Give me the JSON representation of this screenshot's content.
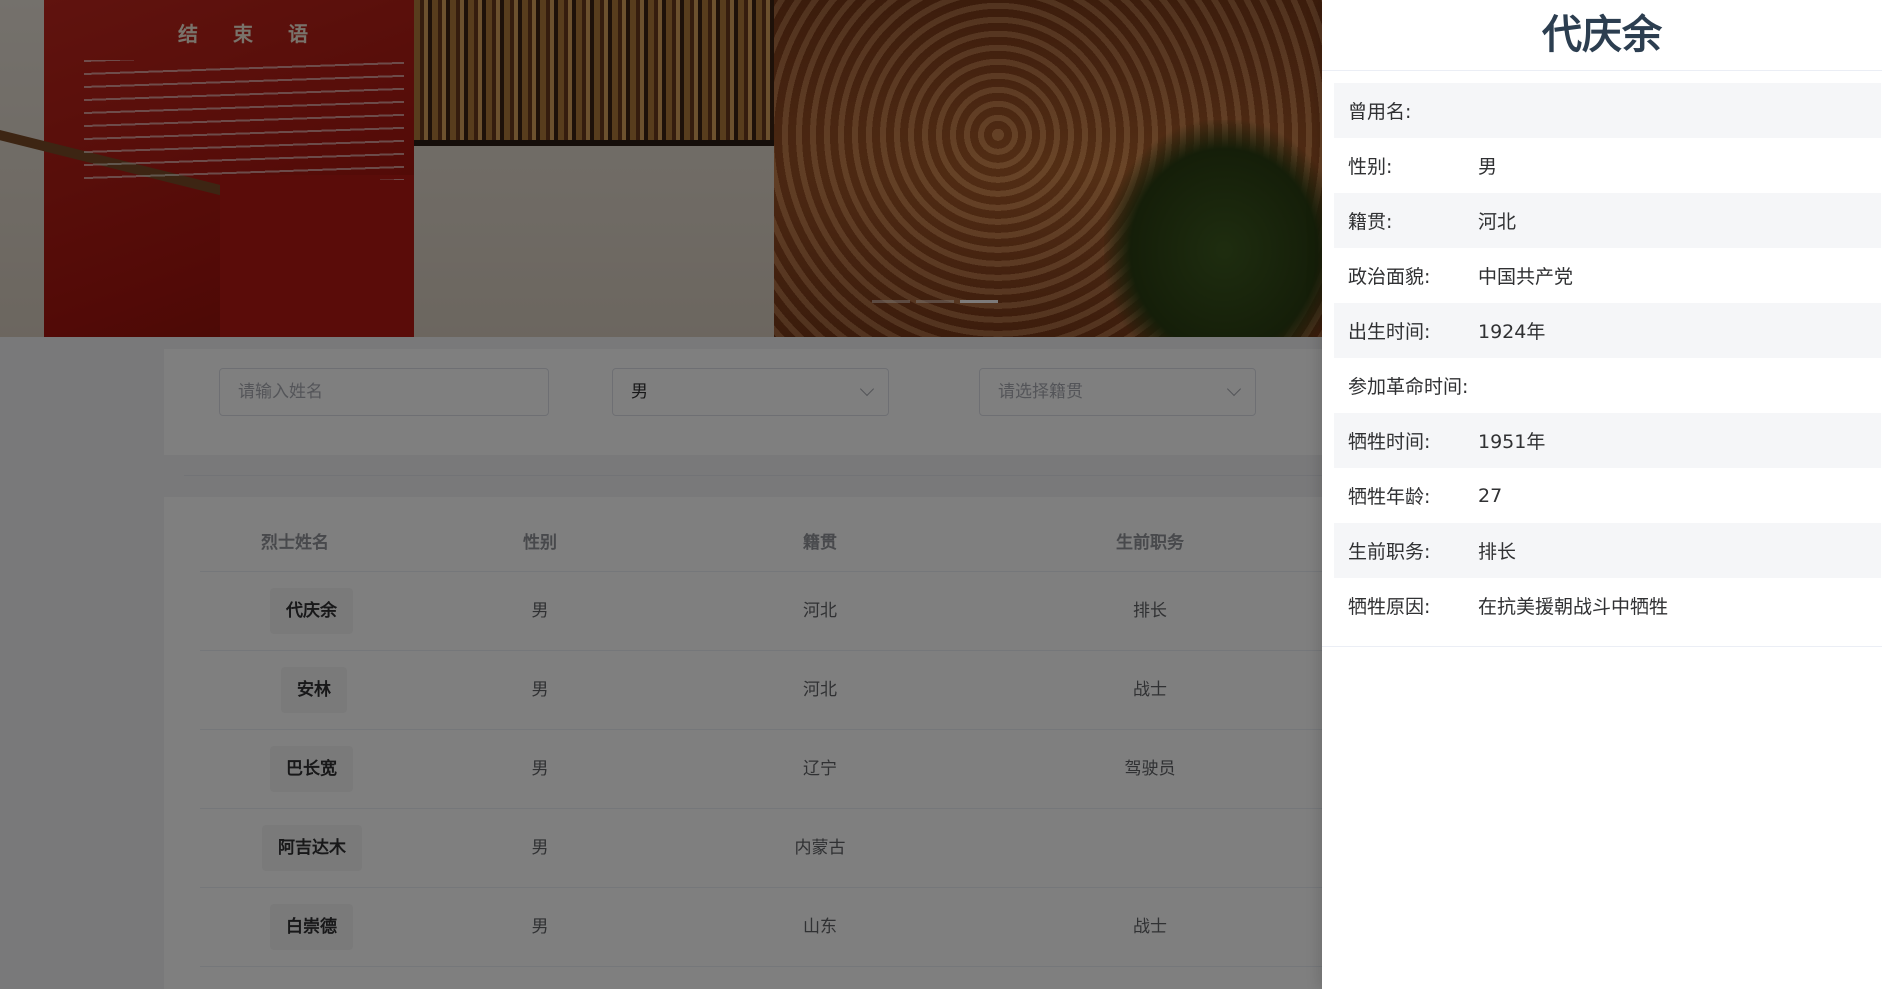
{
  "banner": {
    "left_slide_heading": "结 束 语",
    "indicators": [
      {
        "active": false
      },
      {
        "active": false
      },
      {
        "active": true
      }
    ]
  },
  "search": {
    "name_placeholder": "请输入姓名",
    "gender_value": "男",
    "hometown_placeholder": "请选择籍贯"
  },
  "table": {
    "headers": [
      "烈士姓名",
      "性别",
      "籍贯",
      "生前职务"
    ],
    "rows": [
      {
        "name": "代庆余",
        "gender": "男",
        "hometown": "河北",
        "position": "排长"
      },
      {
        "name": "安林",
        "gender": "男",
        "hometown": "河北",
        "position": "战士"
      },
      {
        "name": "巴长宽",
        "gender": "男",
        "hometown": "辽宁",
        "position": "驾驶员"
      },
      {
        "name": "阿吉达木",
        "gender": "男",
        "hometown": "内蒙古",
        "position": ""
      },
      {
        "name": "白崇德",
        "gender": "男",
        "hometown": "山东",
        "position": "战士"
      }
    ]
  },
  "drawer": {
    "title": "代庆余",
    "fields": [
      {
        "label": "曾用名:",
        "value": ""
      },
      {
        "label": "性别:",
        "value": "男"
      },
      {
        "label": "籍贯:",
        "value": "河北"
      },
      {
        "label": "政治面貌:",
        "value": "中国共产党"
      },
      {
        "label": "出生时间:",
        "value": "1924年"
      },
      {
        "label": "参加革命时间:",
        "value": ""
      },
      {
        "label": "牺牲时间:",
        "value": "1951年"
      },
      {
        "label": "牺牲年龄:",
        "value": "27"
      },
      {
        "label": "生前职务:",
        "value": "排长"
      },
      {
        "label": "牺牲原因:",
        "value": "在抗美援朝战斗中牺牲"
      }
    ]
  }
}
